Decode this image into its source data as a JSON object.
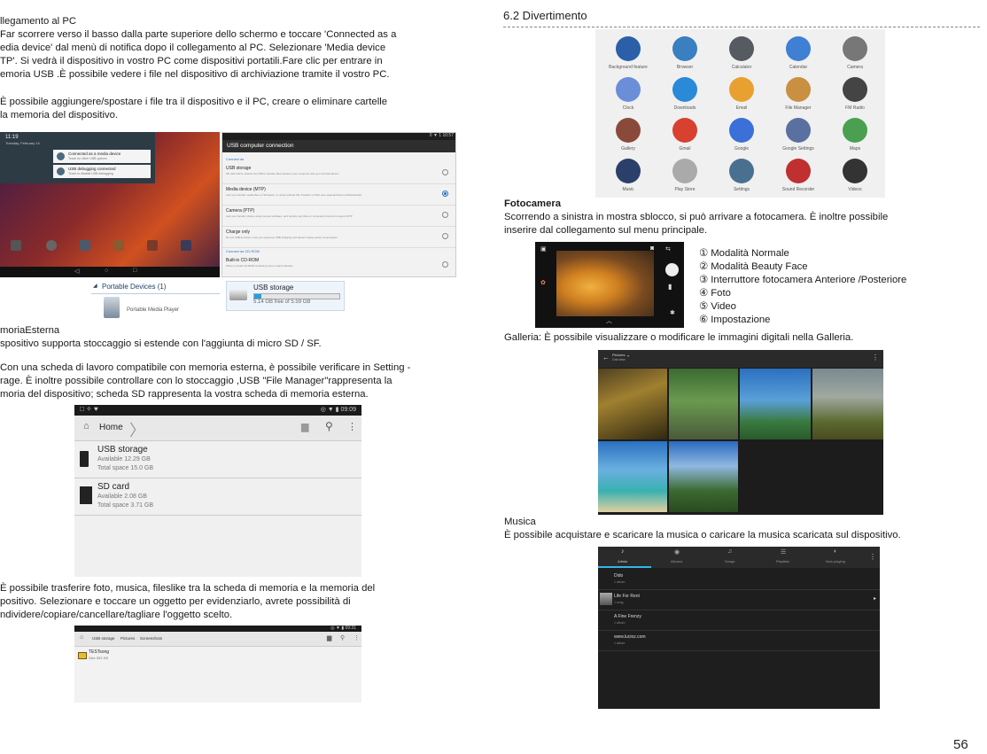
{
  "left": {
    "p1_lines": [
      "llegamento al PC",
      "Far scorrere verso il basso dalla parte superiore dello schermo e toccare 'Connected as a",
      "edia device' dal menù di notifica dopo il collegamento al PC. Selezionare 'Media device",
      "TP'. Si vedrà il dispositivo in vostro PC come dispositivi portatili.Fare clic per entrare in",
      "emoria USB .È possibile vedere i file nel dispositivo di archiviazione tramite il vostro PC."
    ],
    "p2_lines": [
      "È possibile aggiungere/spostare i file tra il dispositivo e il PC, creare o eliminare cartelle",
      "la memoria del dispositivo."
    ],
    "notif": {
      "time": "11:19",
      "date": "Tuesday, February 14",
      "item1_title": "Connected as a media device",
      "item1_sub": "Touch for other USB options",
      "item2_title": "USB debugging connected",
      "item2_sub": "Touch to disable USB debugging"
    },
    "usbconn": {
      "status": "0 ▼ 1 10:57",
      "header": "USB computer connection",
      "section1": "Connect as",
      "options": [
        {
          "title": "USB storage",
          "desc": "SD card will be shared via USB to transfer files between your computer and your Android device",
          "checked": false
        },
        {
          "title": "Media device (MTP)",
          "desc": "Lets you transfer media files on Windows, or using Android File Transfer on Mac (see www.android.com/filetransfer)",
          "checked": true
        },
        {
          "title": "Camera (PTP)",
          "desc": "Lets you transfer photos using camera software, and transfer any files on computers that don't support MTP",
          "checked": false
        },
        {
          "title": "Charge only",
          "desc": "Do not USB functions. Lets you speed up USB charging and doesn't waste power consumption",
          "checked": false
        }
      ],
      "section2": "Connect as CD-ROM",
      "cd_title": "Built-in CD-ROM",
      "cd_desc": "Show a virtual CD-ROM containing some useful software"
    },
    "explorer": {
      "header": "Portable Devices (1)",
      "device": "Portable Media Player",
      "usb_title": "USB storage",
      "usb_free": "5.14 GB free of 5.59 GB",
      "usb_fill": 0.08
    },
    "p3_lines": [
      "moriaEsterna",
      "spositivo supporta stoccaggio si estende con l'aggiunta di micro SD / SF."
    ],
    "p4_lines": [
      "Con una scheda di lavoro compatibile con memoria esterna, è possibile verificare in Setting -",
      "rage. È inoltre possibile controllare con lo stoccaggio ,USB \"File Manager\"rappresenta la",
      "moria del dispositivo; scheda SD rappresenta la vostra scheda di memoria esterna."
    ],
    "filemgr": {
      "status": "◎ ▼ ▮ 09:09",
      "home": "Home",
      "usb_title": "USB storage",
      "usb_avail": "Available 12.29 GB",
      "usb_total": "Total space 15.0 GB",
      "sd_title": "SD card",
      "sd_avail": "Available 2.08 GB",
      "sd_total": "Total space 3.71 GB"
    },
    "p5_lines": [
      "È possibile trasferire foto, musica, fileslike tra la scheda di memoria e la memoria del",
      "positivo. Selezionare e toccare un oggetto per evidenziarlo, avrete possibilità di",
      "ndividere/copiare/cancellare/tagliare l'oggetto scelto."
    ],
    "filemgr2": {
      "status": "◎ ▼ ▮ 09:31",
      "crumbs": [
        "USB storage",
        "Pictures",
        "Screenshots"
      ],
      "file_name": "TESTsong",
      "file_size": "Size 551 KB"
    }
  },
  "right": {
    "title": "6.2 Divertimento",
    "apps": [
      {
        "label": "Background feature",
        "icon": "bg-feature-icon",
        "color": "#2b5fa8"
      },
      {
        "label": "Browser",
        "icon": "browser-icon",
        "color": "#3a7fc0"
      },
      {
        "label": "Calculator",
        "icon": "calculator-icon",
        "color": "#555b60"
      },
      {
        "label": "Calendar",
        "icon": "calendar-icon",
        "color": "#3f7fd4"
      },
      {
        "label": "Camera",
        "icon": "camera-icon",
        "color": "#777"
      },
      {
        "label": "Clock",
        "icon": "clock-icon",
        "color": "#6a8ed8"
      },
      {
        "label": "Downloads",
        "icon": "downloads-icon",
        "color": "#2a8ad8"
      },
      {
        "label": "Email",
        "icon": "email-icon",
        "color": "#e8a030"
      },
      {
        "label": "File Manager",
        "icon": "file-manager-icon",
        "color": "#c89040"
      },
      {
        "label": "FM Radio",
        "icon": "fm-radio-icon",
        "color": "#444"
      },
      {
        "label": "Gallery",
        "icon": "gallery-icon",
        "color": "#8a4a3a"
      },
      {
        "label": "Gmail",
        "icon": "gmail-icon",
        "color": "#d84030"
      },
      {
        "label": "Google",
        "icon": "google-icon",
        "color": "#3a70d8"
      },
      {
        "label": "Google Settings",
        "icon": "google-settings-icon",
        "color": "#5a70a0"
      },
      {
        "label": "Maps",
        "icon": "maps-icon",
        "color": "#4aa050"
      },
      {
        "label": "Music",
        "icon": "music-icon",
        "color": "#2a3f6a"
      },
      {
        "label": "Play Store",
        "icon": "play-store-icon",
        "color": "#aaa"
      },
      {
        "label": "Settings",
        "icon": "settings-icon",
        "color": "#4a7090"
      },
      {
        "label": "Sound Recorder",
        "icon": "sound-recorder-icon",
        "color": "#c03030"
      },
      {
        "label": "Videos",
        "icon": "videos-icon",
        "color": "#333"
      }
    ],
    "camera_title": "Fotocamera",
    "camera_lines": [
      "Scorrendo a sinistra in mostra sblocco, si può arrivare a fotocamera. È inoltre possibile",
      "inserire dal collegamento sul menu principale."
    ],
    "camera_list": [
      "① Modalità Normale",
      "② Modalità Beauty Face",
      "③ Interruttore fotocamera Anteriore /Posteriore",
      "④ Foto",
      "⑤ Video",
      "⑥ Impostazione"
    ],
    "gallery_line": "Galleria: È possibile visualizzare o modificare le immagini digitali nella Galleria.",
    "gallery_header": "Pictures",
    "gallery_sub": "Grid view",
    "music_title": "Musica",
    "music_line": "È possibile acquistare e scaricare la musica o caricare la musica scaricata sul dispositivo.",
    "music_tabs": [
      "Artists",
      "Albums",
      "Songs",
      "Playlists",
      "Now playing"
    ],
    "music_items": [
      {
        "name": "Dido",
        "sub": "1 album"
      },
      {
        "name": "Life For Rent",
        "sub": "1 song"
      },
      {
        "name": "A Fine Frenzy",
        "sub": "1 album"
      },
      {
        "name": "www.lucioz.com",
        "sub": "1 album"
      }
    ]
  },
  "page_number": "56"
}
